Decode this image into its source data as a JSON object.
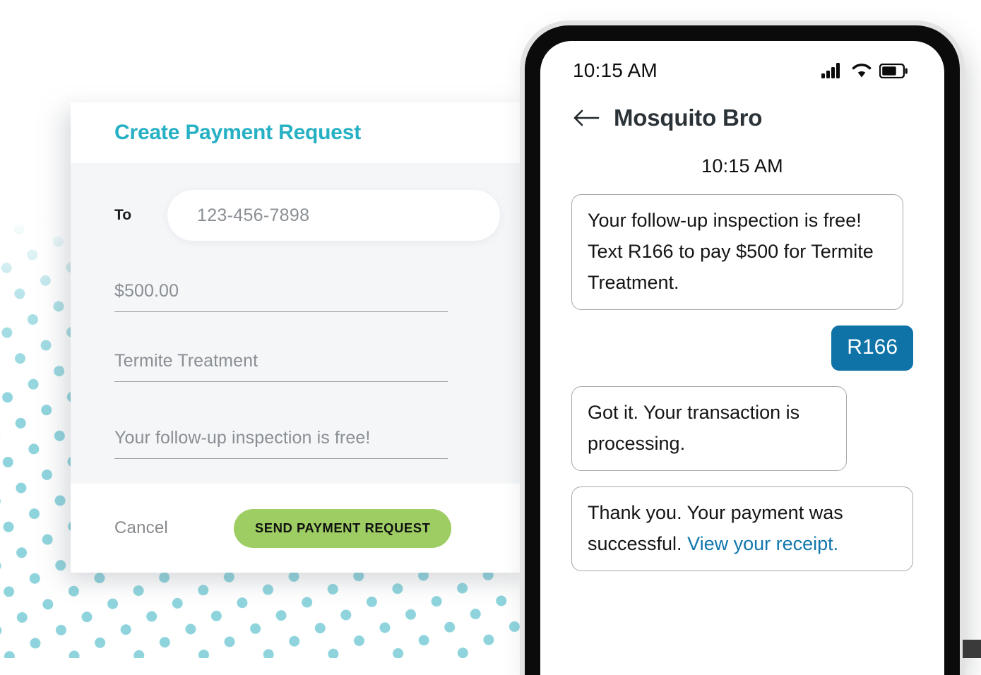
{
  "card": {
    "title": "Create Payment Request",
    "to_label": "To",
    "to_value": "123-456-7898",
    "amount": "$500.00",
    "description": "Termite Treatment",
    "note": "Your follow-up inspection is free!",
    "cancel_label": "Cancel",
    "send_label": "SEND PAYMENT REQUEST",
    "accent_color": "#26b0c4",
    "send_button_color": "#9ece63"
  },
  "phone": {
    "status_bar": {
      "time": "10:15 AM",
      "signal_icon": "cellular-signal-icon",
      "wifi_icon": "wifi-icon",
      "battery_icon": "battery-icon"
    },
    "chat_header": {
      "back_icon": "back-arrow-icon",
      "contact_name": "Mosquito Bro"
    },
    "conversation": {
      "timestamp": "10:15 AM",
      "messages": [
        {
          "direction": "incoming",
          "text": "Your follow-up inspection is free! Text R166 to pay $500 for Termite Treatment."
        },
        {
          "direction": "outgoing",
          "text": "R166"
        },
        {
          "direction": "incoming",
          "text": "Got it. Your transaction is processing."
        },
        {
          "direction": "incoming",
          "text": "Thank you. Your payment was successful. ",
          "link_text": "View your receipt."
        }
      ],
      "outgoing_bubble_color": "#0f73a8",
      "link_color": "#1177ac"
    }
  },
  "background": {
    "dot_color": "#8fd4dd"
  }
}
